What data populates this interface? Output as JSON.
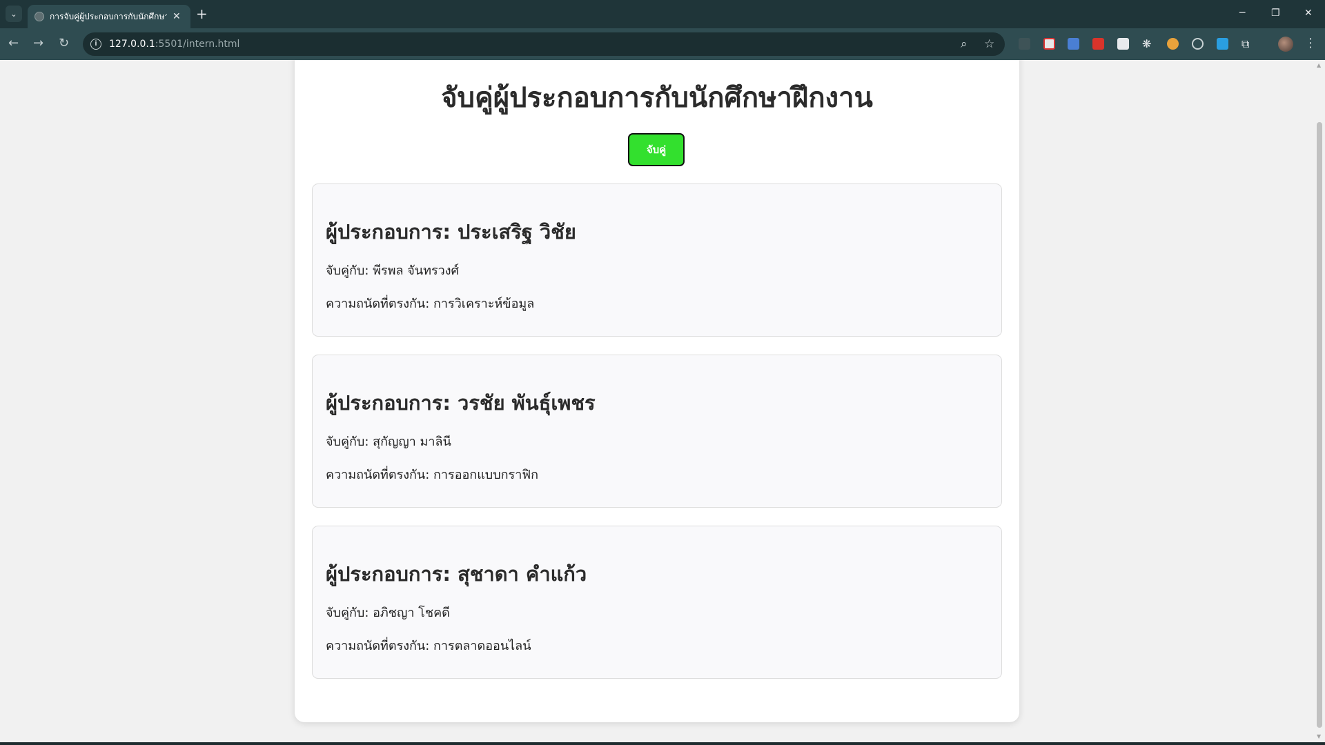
{
  "browser": {
    "tab_title": "การจับคู่ผู้ประกอบการกับนักศึกษาฝึกงาน",
    "url_host": "127.0.0.1",
    "url_rest": ":5501/intern.html",
    "new_tab_symbol": "+",
    "close_symbol": "✕"
  },
  "page": {
    "title": "จับคู่ผู้ประกอบการกับนักศึกษาฝึกงาน",
    "match_button_label": "จับคู่",
    "accent_color": "#33e02e"
  },
  "matches": [
    {
      "entrepreneur": "ผู้ประกอบการ: ประเสริฐ วิชัย",
      "matched_with": "จับคู่กับ: พีรพล จันทรวงศ์",
      "skill": "ความถนัดที่ตรงกัน: การวิเคราะห์ข้อมูล"
    },
    {
      "entrepreneur": "ผู้ประกอบการ: วรชัย พันธุ์เพชร",
      "matched_with": "จับคู่กับ: สุกัญญา มาลินี",
      "skill": "ความถนัดที่ตรงกัน: การออกแบบกราฟิก"
    },
    {
      "entrepreneur": "ผู้ประกอบการ: สุชาดา คำแก้ว",
      "matched_with": "จับคู่กับ: อภิชญา โชคดี",
      "skill": "ความถนัดที่ตรงกัน: การตลาดออนไลน์"
    }
  ]
}
